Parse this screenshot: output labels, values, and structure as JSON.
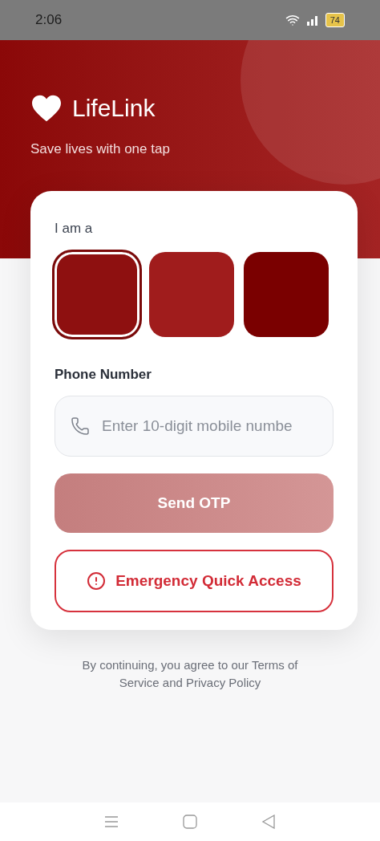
{
  "status_bar": {
    "time": "2:06",
    "battery": "74"
  },
  "header": {
    "app_name": "LifeLink",
    "tagline": "Save lives with one tap"
  },
  "form": {
    "role_label": "I am a",
    "roles": [
      {
        "selected": true,
        "color": "#8e1010"
      },
      {
        "selected": false,
        "color": "#a01c1c"
      },
      {
        "selected": false,
        "color": "#7a0000"
      }
    ],
    "phone_label": "Phone Number",
    "phone_field": {
      "placeholder": "Enter 10-digit mobile numbe"
    },
    "send_button": {
      "label": "Send OTP",
      "disabled": true
    },
    "emergency_button": {
      "label": "Emergency Quick Access"
    }
  },
  "footer": {
    "text": "By continuing, you agree to our Terms of Service and Privacy Policy"
  }
}
